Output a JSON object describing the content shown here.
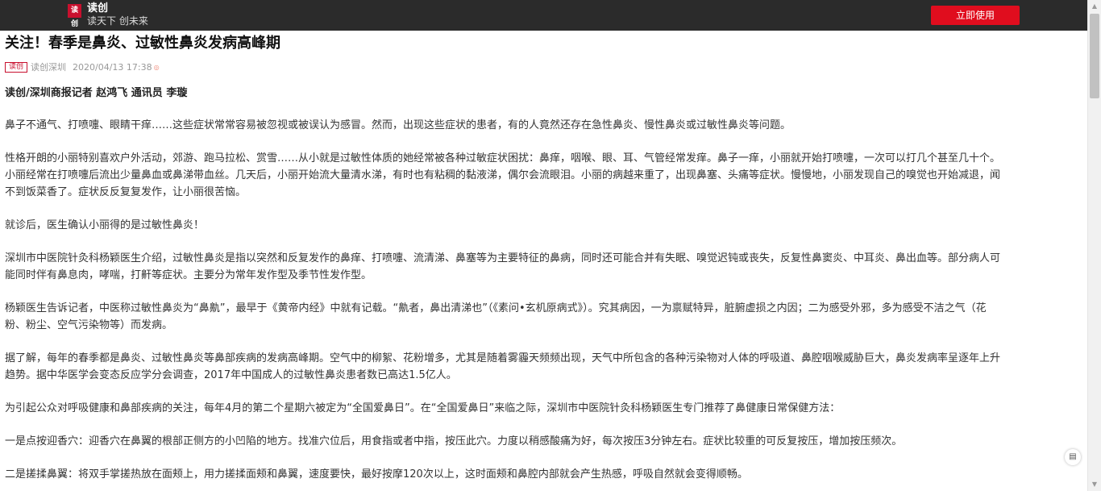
{
  "header": {
    "logo_text": "读创",
    "app_name": "读创",
    "slogan": "读天下 创未来",
    "open_button": "立即使用"
  },
  "article": {
    "title": "关注！春季是鼻炎、过敏性鼻炎发病高峰期",
    "meta_logo": "读创",
    "source": "读创深圳",
    "datetime": "2020/04/13 17:38",
    "byline": "读创/深圳商报记者 赵鸿飞 通讯员 李璇",
    "paragraphs": [
      [
        "鼻子不通气、打喷嚏、眼睛干痒……这些症状常常容易被忽视或被误认为感冒。然而，出现这些症状的患者，有的人竟然还存在急性鼻炎、慢性鼻炎或过敏性鼻炎等问题。"
      ],
      [
        "性格开朗的小丽特别喜欢户外活动，郊游、跑马拉松、赏雪……从小就是过敏性体质的她经常被各种过敏症状困扰：鼻痒，咽喉、眼、耳、气管经常发痒。鼻子一痒，小丽就开始打喷嚏，一次可以打几个甚至几十个。",
        "小丽经常在打喷嚏后流出少量鼻血或鼻涕带血丝。几天后，小丽开始流大量清水涕，有时也有粘稠的黏液涕，偶尔会流眼泪。小丽的病越来重了，出现鼻塞、头痛等症状。慢慢地，小丽发现自己的嗅觉也开始减退，闻",
        "不到饭菜香了。症状反反复复发作，让小丽很苦恼。"
      ],
      [
        "就诊后，医生确认小丽得的是过敏性鼻炎！"
      ],
      [
        "深圳市中医院针灸科杨颖医生介绍，过敏性鼻炎是指以突然和反复发作的鼻痒、打喷嚏、流清涕、鼻塞等为主要特征的鼻病，同时还可能合并有失眠、嗅觉迟钝或丧失，反复性鼻窦炎、中耳炎、鼻出血等。部分病人可",
        "能同时伴有鼻息肉，哮喘，打鼾等症状。主要分为常年发作型及季节性发作型。"
      ],
      [
        "杨颖医生告诉记者，中医称过敏性鼻炎为“鼻鼽”，最早于《黄帝内经》中就有记载。“鼽者，鼻出清涕也”（《素问•玄机原病式》）。究其病因，一为禀赋特异，脏腑虚损之内因；二为感受外邪，多为感受不洁之气（花",
        "粉、粉尘、空气污染物等）而发病。"
      ],
      [
        "据了解，每年的春季都是鼻炎、过敏性鼻炎等鼻部疾病的发病高峰期。空气中的柳絮、花粉增多，尤其是随着雾霾天频频出现，天气中所包含的各种污染物对人体的呼吸道、鼻腔咽喉威胁巨大，鼻炎发病率呈逐年上升",
        "趋势。据中华医学会变态反应学分会调查，2017年中国成人的过敏性鼻炎患者数已高达1.5亿人。"
      ],
      [
        "为引起公众对呼吸健康和鼻部疾病的关注，每年4月的第二个星期六被定为“全国爱鼻日”。在“全国爱鼻日”来临之际，深圳市中医院针灸科杨颖医生专门推荐了鼻健康日常保健方法："
      ],
      [
        "一是点按迎香穴：迎香穴在鼻翼的根部正侧方的小凹陷的地方。找准穴位后，用食指或者中指，按压此穴。力度以稍感酸痛为好，每次按压3分钟左右。症状比较重的可反复按压，增加按压频次。"
      ],
      [
        "二是搓揉鼻翼：将双手掌搓热放在面颊上，用力搓揉面颊和鼻翼，速度要快，最好按摩120次以上，这时面颊和鼻腔内部就会产生热感，呼吸自然就会变得顺畅。"
      ]
    ]
  }
}
